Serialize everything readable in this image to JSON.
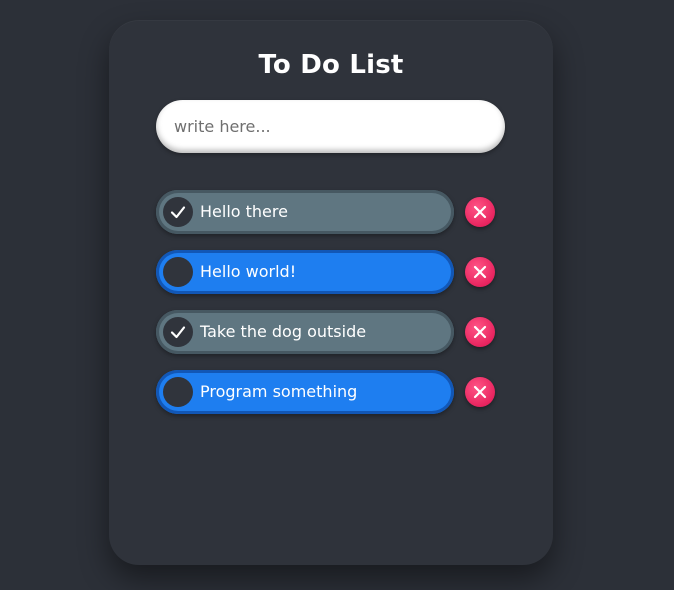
{
  "title": "To Do List",
  "input": {
    "placeholder": "write here..."
  },
  "items": [
    {
      "label": "Hello there",
      "done": true
    },
    {
      "label": "Hello world!",
      "done": false
    },
    {
      "label": "Take the dog outside",
      "done": true
    },
    {
      "label": "Program something",
      "done": false
    }
  ],
  "icons": {
    "check": "check-icon",
    "delete": "close-icon"
  },
  "colors": {
    "background": "#2c3038",
    "card": "#2f333b",
    "done_item": "#5f7681",
    "todo_item": "#1e7ef0",
    "delete_button": "#e8245f",
    "check_circle": "#30343c"
  }
}
